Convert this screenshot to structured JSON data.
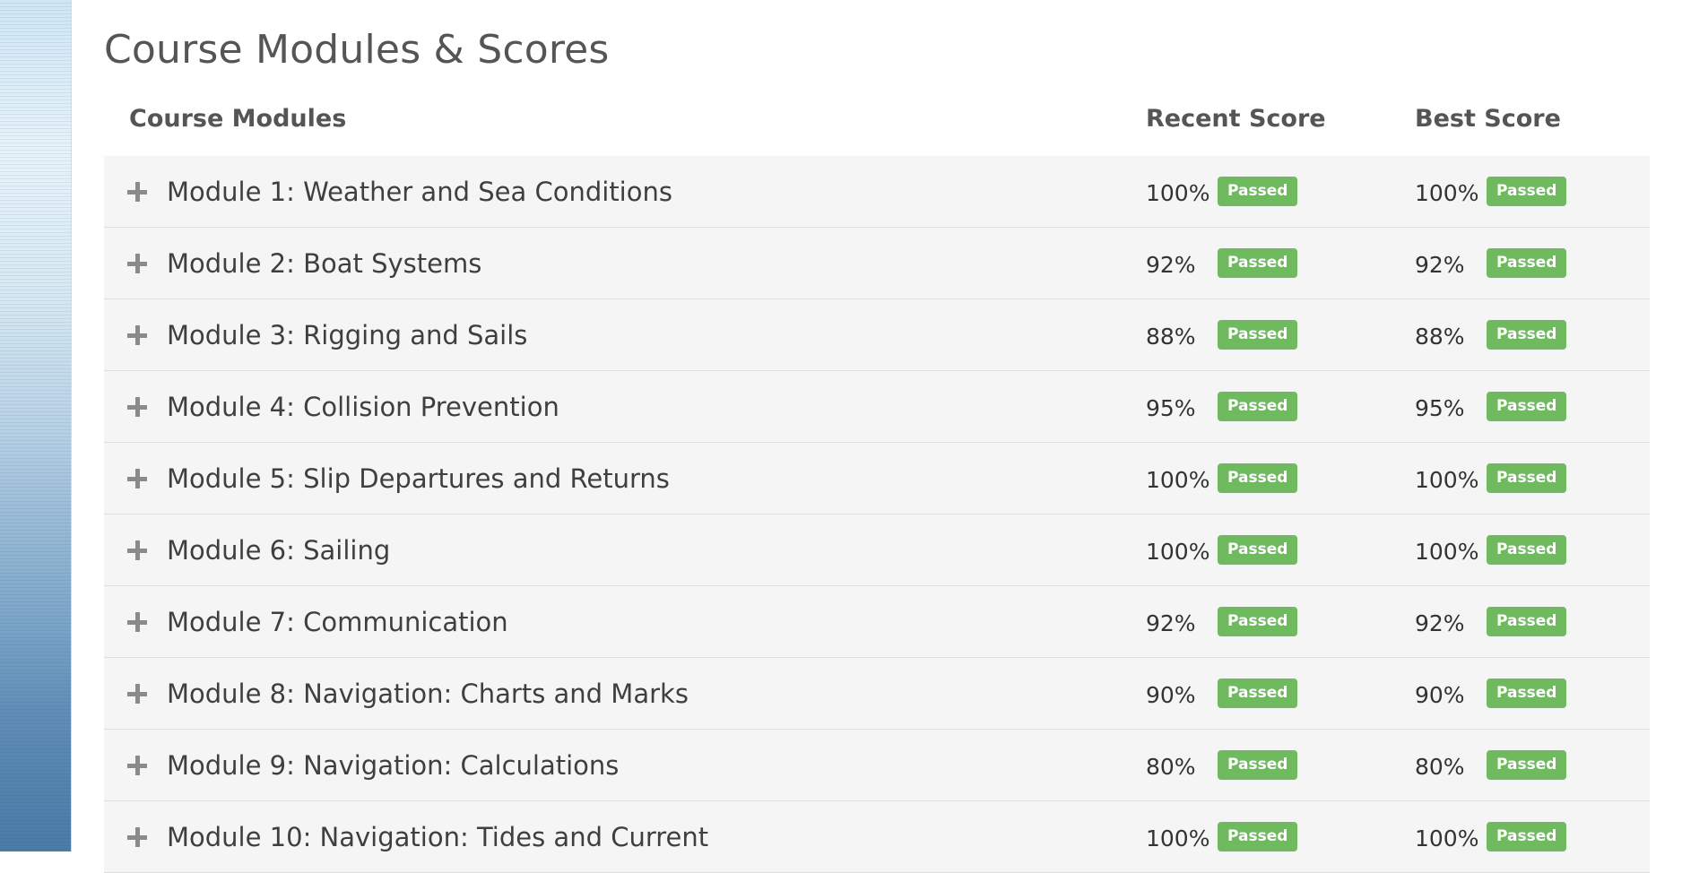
{
  "page_title": "Course Modules & Scores",
  "table": {
    "headers": {
      "modules": "Course Modules",
      "recent": "Recent Score",
      "best": "Best Score"
    },
    "rows": [
      {
        "label": "Module 1: Weather and Sea Conditions",
        "recent": "100%",
        "recent_status": "Passed",
        "best": "100%",
        "best_status": "Passed"
      },
      {
        "label": "Module 2: Boat Systems",
        "recent": "92%",
        "recent_status": "Passed",
        "best": "92%",
        "best_status": "Passed"
      },
      {
        "label": "Module 3: Rigging and Sails",
        "recent": "88%",
        "recent_status": "Passed",
        "best": "88%",
        "best_status": "Passed"
      },
      {
        "label": "Module 4: Collision Prevention",
        "recent": "95%",
        "recent_status": "Passed",
        "best": "95%",
        "best_status": "Passed"
      },
      {
        "label": "Module 5: Slip Departures and Returns",
        "recent": "100%",
        "recent_status": "Passed",
        "best": "100%",
        "best_status": "Passed"
      },
      {
        "label": "Module 6: Sailing",
        "recent": "100%",
        "recent_status": "Passed",
        "best": "100%",
        "best_status": "Passed"
      },
      {
        "label": "Module 7: Communication",
        "recent": "92%",
        "recent_status": "Passed",
        "best": "92%",
        "best_status": "Passed"
      },
      {
        "label": "Module 8: Navigation: Charts and Marks",
        "recent": "90%",
        "recent_status": "Passed",
        "best": "90%",
        "best_status": "Passed"
      },
      {
        "label": "Module 9: Navigation: Calculations",
        "recent": "80%",
        "recent_status": "Passed",
        "best": "80%",
        "best_status": "Passed"
      },
      {
        "label": "Module 10: Navigation: Tides and Current",
        "recent": "100%",
        "recent_status": "Passed",
        "best": "100%",
        "best_status": "Passed"
      }
    ]
  },
  "icons": {
    "expand": "plus-icon"
  },
  "colors": {
    "badge_passed": "#6fba5f",
    "row_background": "#f5f5f5"
  }
}
